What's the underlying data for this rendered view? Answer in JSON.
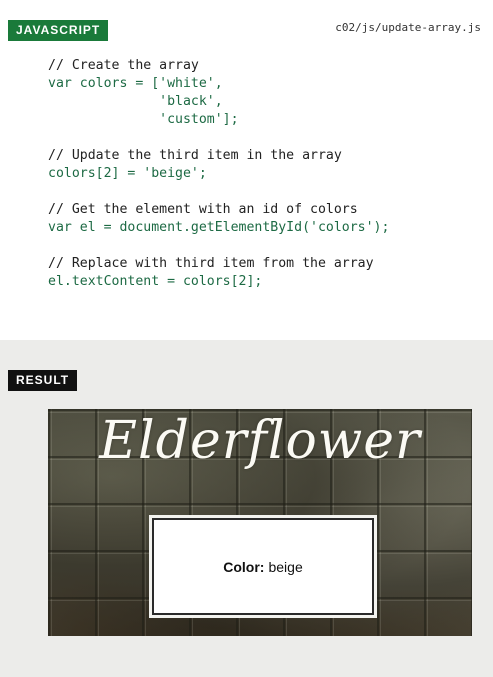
{
  "code_section": {
    "tag": "JAVASCRIPT",
    "filename": "c02/js/update-array.js",
    "lines": [
      "// Create the array",
      "var colors = ['white',",
      "              'black',",
      "              'custom'];",
      "",
      "// Update the third item in the array",
      "colors[2] = 'beige';",
      "",
      "// Get the element with an id of colors",
      "var el = document.getElementById('colors');",
      "",
      "// Replace with third item from the array",
      "el.textContent = colors[2];"
    ]
  },
  "result_section": {
    "tag": "RESULT",
    "brand": "Elderflower",
    "color_label": "Color:",
    "color_value": "beige"
  },
  "colors": {
    "tag_green": "#1a7a3a",
    "tag_black": "#111111",
    "code_green": "#1d6a44"
  }
}
